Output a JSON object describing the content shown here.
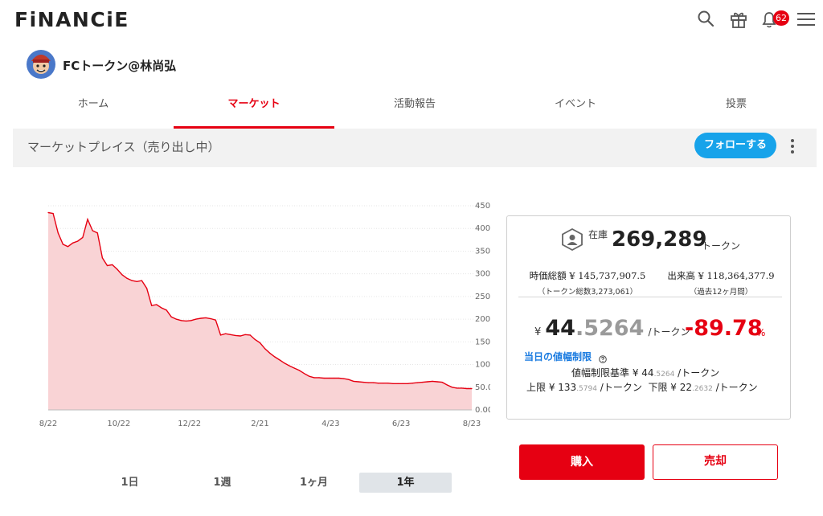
{
  "header": {
    "logo": "FiNANCiE",
    "notification_count": "62"
  },
  "token": {
    "name": "FCトークン@林尚弘"
  },
  "tabs": [
    {
      "label": "ホーム",
      "active": false
    },
    {
      "label": "マーケット",
      "active": true
    },
    {
      "label": "活動報告",
      "active": false
    },
    {
      "label": "イベント",
      "active": false
    },
    {
      "label": "投票",
      "active": false
    }
  ],
  "market": {
    "title": "マーケットプレイス（売り出し中）",
    "follow_label": "フォローする"
  },
  "chart_data": {
    "type": "area",
    "x_ticks": [
      "8/22",
      "10/22",
      "12/22",
      "2/21",
      "4/23",
      "6/23",
      "8/23"
    ],
    "y_ticks": [
      "0.0000",
      "50.0000",
      "100.0000",
      "150.0000",
      "200.0000",
      "250.0000",
      "300.0000",
      "350.0000",
      "400.0000",
      "450.0000"
    ],
    "ylim": [
      0,
      450
    ],
    "series": [
      {
        "color": "#e60012",
        "fill": "#f9d3d5",
        "x": [
          "8/22",
          "8/24",
          "8/27",
          "8/29",
          "9/1",
          "9/4",
          "9/8",
          "9/11",
          "9/13",
          "9/15",
          "9/17",
          "9/19",
          "9/22",
          "9/25",
          "9/27",
          "9/30",
          "10/3",
          "10/6",
          "10/10",
          "10/14",
          "10/18",
          "10/22",
          "10/26",
          "10/30",
          "11/3",
          "11/6",
          "11/9",
          "11/12",
          "11/16",
          "11/20",
          "11/24",
          "11/28",
          "12/2",
          "12/6",
          "12/10",
          "12/14",
          "12/18",
          "12/21",
          "12/25",
          "12/29",
          "1/2",
          "1/6",
          "1/10",
          "1/14",
          "1/18",
          "1/22",
          "1/26",
          "1/30",
          "2/3",
          "2/7",
          "2/11",
          "2/15",
          "2/19",
          "2/23",
          "2/27",
          "3/3",
          "3/8",
          "3/12",
          "3/16",
          "3/20",
          "3/24",
          "3/28",
          "4/2",
          "4/8",
          "4/14",
          "4/20",
          "4/26",
          "5/2",
          "5/8",
          "5/14",
          "5/20",
          "5/26",
          "6/1",
          "6/7",
          "6/13",
          "6/19",
          "6/25",
          "7/1",
          "7/7",
          "7/13",
          "7/19",
          "7/25",
          "7/31",
          "8/6",
          "8/12",
          "8/18",
          "8/23"
        ],
        "values": [
          435,
          433,
          390,
          365,
          360,
          368,
          372,
          380,
          420,
          395,
          390,
          335,
          318,
          320,
          310,
          298,
          290,
          285,
          283,
          285,
          268,
          230,
          232,
          225,
          220,
          205,
          200,
          197,
          196,
          197,
          200,
          202,
          203,
          201,
          198,
          165,
          168,
          166,
          164,
          163,
          166,
          165,
          155,
          148,
          135,
          125,
          117,
          110,
          103,
          97,
          92,
          87,
          80,
          74,
          71,
          71,
          70,
          70,
          70,
          70,
          69,
          67,
          63,
          62,
          61,
          60,
          60,
          59,
          59,
          59,
          58,
          58,
          58,
          58,
          59,
          60,
          61,
          62,
          63,
          62,
          61,
          55,
          50,
          48,
          48,
          47,
          47
        ]
      }
    ]
  },
  "periods": [
    {
      "label": "1日",
      "active": false
    },
    {
      "label": "1週",
      "active": false
    },
    {
      "label": "1ヶ月",
      "active": false
    },
    {
      "label": "1年",
      "active": true
    }
  ],
  "info": {
    "stock_label": "在庫",
    "stock_value": "269,289",
    "stock_unit": "トークン",
    "market_cap_label": "時価総額",
    "market_cap_value": "¥ 145,737,907.5",
    "market_cap_sub": "（トークン総数3,273,061）",
    "volume_label": "出来高",
    "volume_value": "¥ 118,364,377.9",
    "volume_sub": "（過去12ヶ月間）",
    "price_yen": "¥",
    "price_int": "44",
    "price_dec": ".5264",
    "price_unit": "/トークン",
    "change_value": "-89.78",
    "change_unit": "%",
    "limit_title": "当日の値幅制限",
    "limit_base_label": "値幅制限基準 ¥",
    "limit_base_int": "44",
    "limit_base_dec": ".5264",
    "limit_base_unit": "/トークン",
    "upper_label": "上限 ¥",
    "upper_int": "133",
    "upper_dec": ".5794",
    "upper_unit": "/トークン",
    "lower_label": "下限 ¥",
    "lower_int": "22",
    "lower_dec": ".2632",
    "lower_unit": "/トークン"
  },
  "actions": {
    "buy_label": "購入",
    "sell_label": "売却"
  }
}
